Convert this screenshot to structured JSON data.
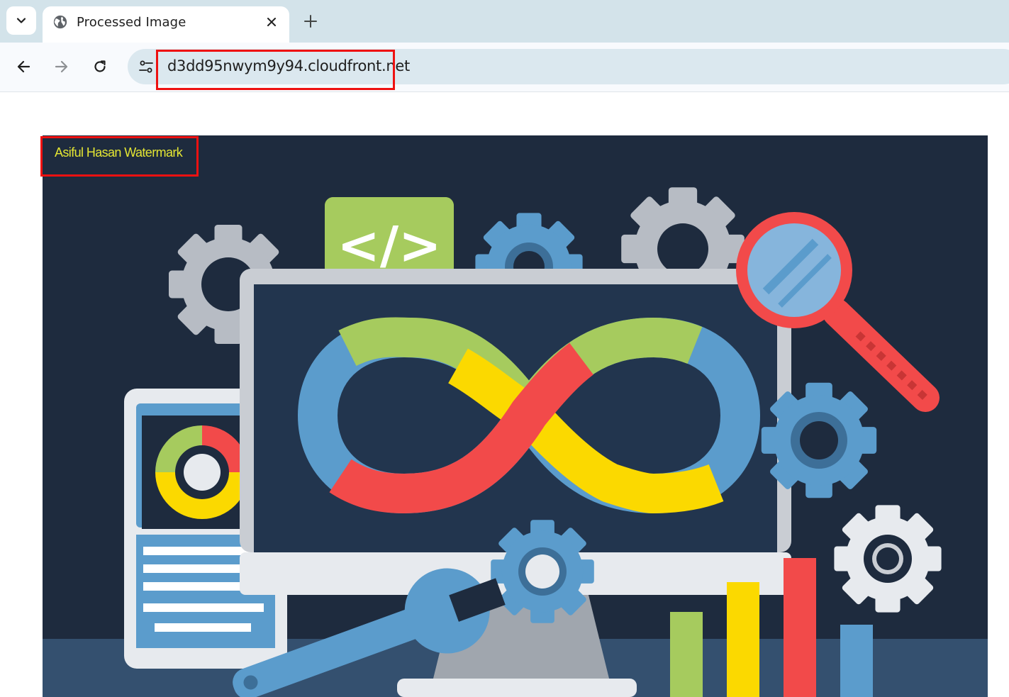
{
  "browser": {
    "tab": {
      "title": "Processed Image",
      "favicon": "globe-icon"
    },
    "controls": {
      "tab_search_icon": "chevron-down-icon",
      "close_icon": "close-icon",
      "new_tab_icon": "plus-icon",
      "back_icon": "arrow-left-icon",
      "forward_icon": "arrow-right-icon",
      "reload_icon": "reload-icon",
      "site_info_icon": "tune-icon"
    },
    "address_bar": {
      "url": "d3dd95nwym9y94.cloudfront.net"
    }
  },
  "page": {
    "watermark_text": "Asiful Hasan Watermark",
    "image": {
      "subject": "devops-illustration",
      "colors": {
        "background": "#1e2b3e",
        "blue": "#5b9ccc",
        "green": "#a6cb5e",
        "red": "#f24a4a",
        "yellow": "#fbd900",
        "gray": "#b7bcc4"
      }
    }
  },
  "annotations": {
    "highlight_color": "#ee1111"
  }
}
